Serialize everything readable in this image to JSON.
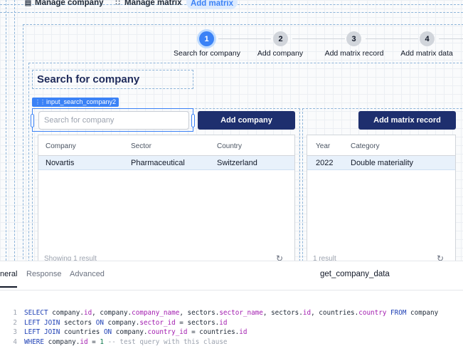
{
  "topnav": {
    "items": [
      {
        "label": "Manage company",
        "icon": "form-icon"
      },
      {
        "label": "Manage matrix",
        "icon": "grid-icon"
      }
    ],
    "active_pill": "Add matrix"
  },
  "stepper": {
    "steps": [
      {
        "number": "1",
        "label": "Search for company",
        "active": true
      },
      {
        "number": "2",
        "label": "Add company",
        "active": false
      },
      {
        "number": "3",
        "label": "Add matrix record",
        "active": false
      },
      {
        "number": "4",
        "label": "Add matrix data",
        "active": false
      }
    ]
  },
  "section_title": "Search for company",
  "component_tag": "input_search_company2",
  "search": {
    "placeholder": "Search for company",
    "value": ""
  },
  "buttons": {
    "add_company": "Add company",
    "add_matrix_record": "Add matrix record"
  },
  "company_table": {
    "columns": [
      "Company",
      "Sector",
      "Country"
    ],
    "rows": [
      [
        "Novartis",
        "Pharmaceutical",
        "Switzerland"
      ]
    ],
    "footer": "Showing 1 result"
  },
  "matrix_table": {
    "columns": [
      "Year",
      "Category"
    ],
    "rows": [
      [
        "2022",
        "Double materiality"
      ]
    ],
    "footer": "1 result"
  },
  "panel": {
    "tabs": [
      "neral",
      "Response",
      "Advanced"
    ],
    "active_tab": "neral",
    "query_name": "get_company_data",
    "line_numbers": [
      "1",
      "2",
      "3",
      "4"
    ]
  },
  "colors": {
    "primary_button": "#1e2f6e",
    "accent": "#3b82f6",
    "selected_row": "#e8f1fb"
  }
}
